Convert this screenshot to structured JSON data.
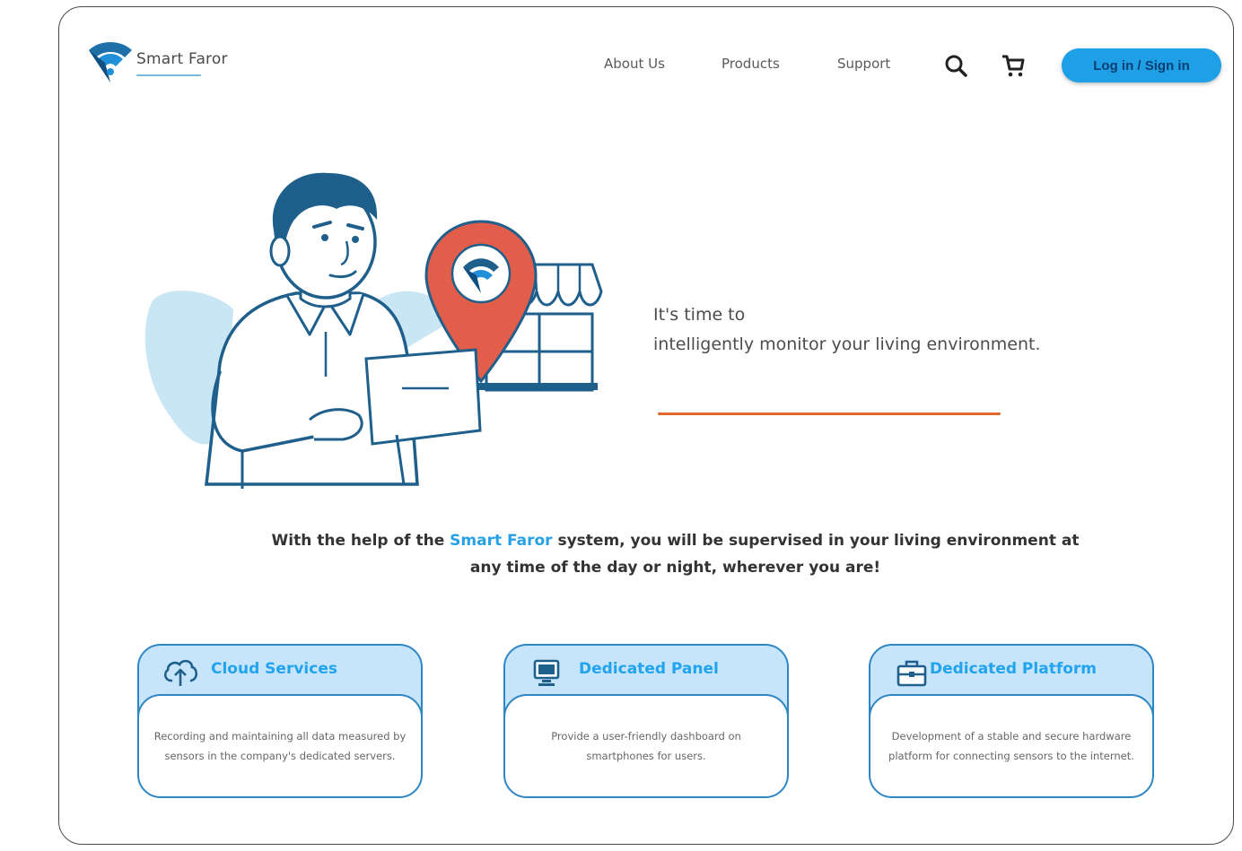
{
  "brand": {
    "name": "Smart Faror",
    "accent": "#1f9fe6"
  },
  "header": {
    "nav": [
      "About Us",
      "Products",
      "Support"
    ],
    "icons": [
      "search-icon",
      "cart-icon"
    ],
    "login_label": "Log in / Sign in"
  },
  "hero": {
    "line1": "It's time to",
    "line2": "intelligently monitor your living environment.",
    "rule_color": "#e2672f"
  },
  "description": {
    "before": "With the help of the ",
    "brand": "Smart Faror",
    "after": " system, you will be supervised in your living environment at any time of the day or night, wherever you are!"
  },
  "cards": [
    {
      "icon": "cloud-upload-icon",
      "title": "Cloud Services",
      "text": "Recording and maintaining all data measured by sensors in the company's dedicated servers."
    },
    {
      "icon": "monitor-icon",
      "title": "Dedicated Panel",
      "text": "Provide a user-friendly dashboard on smartphones for users."
    },
    {
      "icon": "briefcase-icon",
      "title": "Dedicated Platform",
      "text": "Development of a stable and secure hardware platform for connecting sensors to the internet."
    }
  ]
}
